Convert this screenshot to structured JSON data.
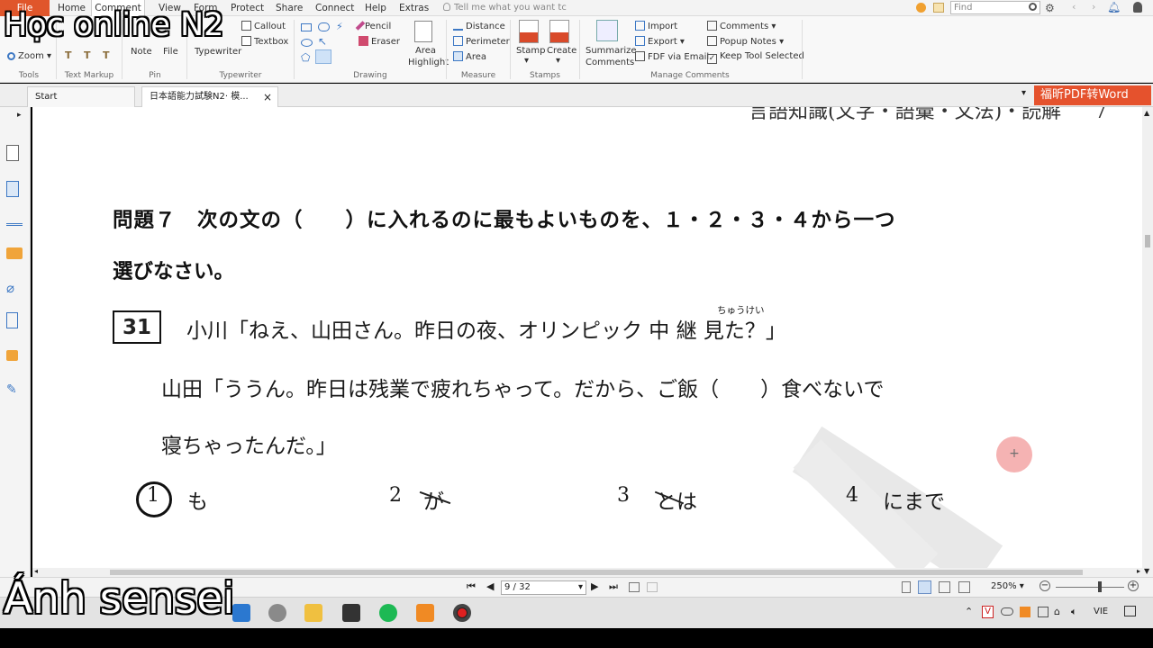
{
  "menu": {
    "items": [
      "File",
      "Home",
      "Comment",
      "View",
      "Form",
      "Protect",
      "Share",
      "Connect",
      "Help",
      "Extras"
    ],
    "active": "Comment",
    "tell_me": "Tell me what you want tc",
    "find_placeholder": "Find"
  },
  "ribbon": {
    "tools": {
      "zoom": "Zoom",
      "label": "Tools"
    },
    "text_markup": {
      "label": "Text Markup",
      "buttons": [
        "T",
        "T",
        "T"
      ]
    },
    "pin": {
      "note": "Note",
      "file": "File",
      "label": "Pin"
    },
    "typewriter": {
      "typewriter": "Typewriter",
      "callout": "Callout",
      "textbox": "Textbox",
      "label": "Typewriter"
    },
    "drawing": {
      "pencil": "Pencil",
      "eraser": "Eraser",
      "area_highlight_1": "Area",
      "area_highlight_2": "Highlight",
      "label": "Drawing"
    },
    "measure": {
      "distance": "Distance",
      "perimeter": "Perimeter",
      "area": "Area",
      "label": "Measure"
    },
    "stamps": {
      "stamp": "Stamp",
      "create": "Create",
      "label": "Stamps"
    },
    "manage": {
      "summarize_1": "Summarize",
      "summarize_2": "Comments",
      "import": "Import",
      "export": "Export",
      "fdf_email": "FDF via Email",
      "comments": "Comments",
      "popup_notes": "Popup Notes",
      "keep_tool": "Keep Tool Selected",
      "label": "Manage Comments"
    }
  },
  "tabs": [
    {
      "label": "Start"
    },
    {
      "label": "日本語能力試験N2· 模..."
    }
  ],
  "pdf2word": "福昕PDF转Word",
  "document": {
    "header_partial": "言語知識(文字・語彙・文法)・読解",
    "header_page": "7",
    "instruction_line1": "問題７　次の文の（　　）に入れるのに最もよいものを、１・２・３・４から一つ",
    "instruction_line2": "選びなさい。",
    "question_number": "31",
    "line1": "小川「ねえ、山田さん。昨日の夜、オリンピック 中 継 見た？」",
    "furigana": "ちゅうけい",
    "line2": "山田「ううん。昨日は残業で疲れちゃって。だから、ご飯（　　）食べないで",
    "line3": "寝ちゃったんだ。」",
    "options": [
      {
        "num": "1",
        "text": "も"
      },
      {
        "num": "2",
        "text": "が"
      },
      {
        "num": "3",
        "text": "とは"
      },
      {
        "num": "4",
        "text": "にまで"
      }
    ],
    "annotation_circle_num": "1"
  },
  "status": {
    "page": "9 / 32",
    "zoom": "250%"
  },
  "taskbar": {
    "lang": "VIE"
  },
  "overlay": {
    "top_left": "Học online N2",
    "bottom_left": "Ánh sensei"
  },
  "colors": {
    "accent": "#e0562b",
    "brand_button": "#e5522d",
    "cursor_marker": "#f4a6a6"
  }
}
